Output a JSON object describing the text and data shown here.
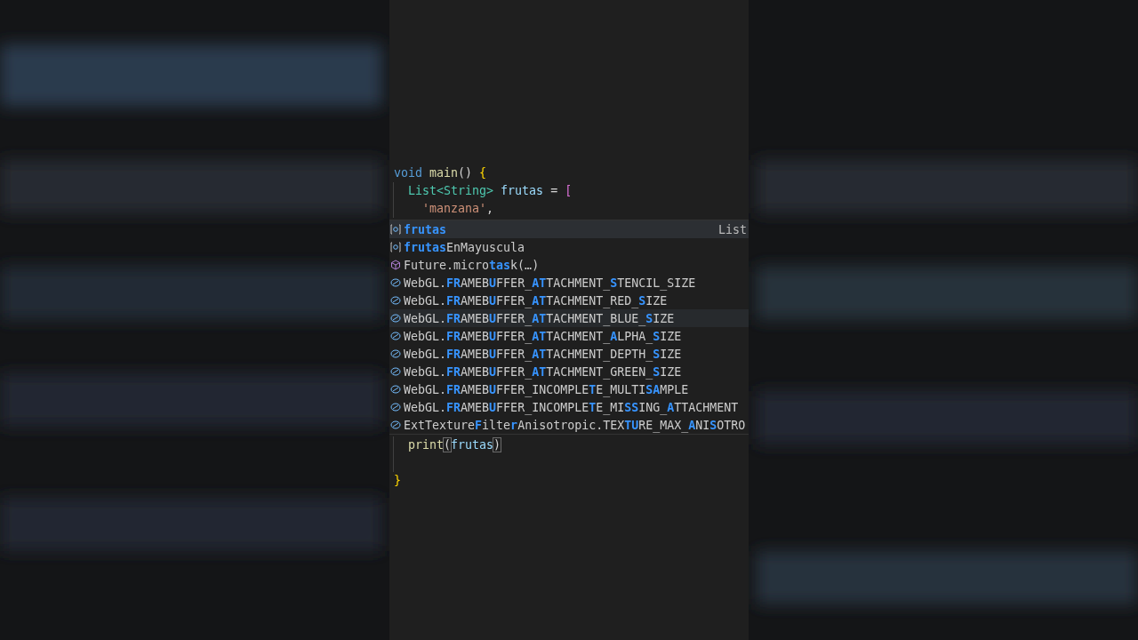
{
  "editor": {
    "lines_before": [
      {
        "guide": false,
        "tokens": [
          {
            "text": "void",
            "kind": "keyword"
          },
          {
            "text": " main",
            "kind": "function"
          },
          {
            "text": "()",
            "kind": "plain"
          },
          {
            "text": " {",
            "kind": "brace"
          }
        ]
      },
      {
        "guide": true,
        "tokens": [
          {
            "text": "  List<String>",
            "kind": "type"
          },
          {
            "text": " frutas",
            "kind": "variable"
          },
          {
            "text": " =",
            "kind": "plain"
          },
          {
            "text": " [",
            "kind": "bracket"
          }
        ]
      },
      {
        "guide": true,
        "tokens": [
          {
            "text": "    'manzana'",
            "kind": "string"
          },
          {
            "text": ",",
            "kind": "plain"
          }
        ]
      }
    ],
    "suggestions": [
      {
        "kind": "variable",
        "label": "**frutas**",
        "detail": "List",
        "selected": true,
        "hovered": false
      },
      {
        "kind": "variable",
        "label": "**frutas**EnMayuscula",
        "selected": false,
        "hovered": false
      },
      {
        "kind": "method",
        "label": "Future.micro**tas**k(…)",
        "selected": false,
        "hovered": false
      },
      {
        "kind": "constant",
        "label": "WebGL.**FR**AMEB**U**FFER_**AT**TACHMENT_**S**TENCIL_SIZE",
        "selected": false,
        "hovered": false
      },
      {
        "kind": "constant",
        "label": "WebGL.**FR**AMEB**U**FFER_**AT**TACHMENT_RED_**S**IZE",
        "selected": false,
        "hovered": false
      },
      {
        "kind": "constant",
        "label": "WebGL.**FR**AMEB**U**FFER_**AT**TACHMENT_BLUE_**S**IZE",
        "selected": false,
        "hovered": true
      },
      {
        "kind": "constant",
        "label": "WebGL.**FR**AMEB**U**FFER_**AT**TACHMENT_**A**LPHA_**S**IZE",
        "selected": false,
        "hovered": false
      },
      {
        "kind": "constant",
        "label": "WebGL.**FR**AMEB**U**FFER_**AT**TACHMENT_DEPTH_**S**IZE",
        "selected": false,
        "hovered": false
      },
      {
        "kind": "constant",
        "label": "WebGL.**FR**AMEB**U**FFER_**AT**TACHMENT_GREEN_**S**IZE",
        "selected": false,
        "hovered": false
      },
      {
        "kind": "constant",
        "label": "WebGL.**FR**AMEB**U**FFER_INCOMPLE**T**E_MULTI**SA**MPLE",
        "selected": false,
        "hovered": false
      },
      {
        "kind": "constant",
        "label": "WebGL.**FR**AMEB**U**FFER_INCOMPLE**T**E_MI**SS**ING_**A**TTACHMENT",
        "selected": false,
        "hovered": false
      },
      {
        "kind": "constant",
        "label": "ExtTexture**F**ilte**r**Anisotropic.TEX**TU**RE_MAX_**A**NI**S**OTRO",
        "selected": false,
        "hovered": false
      }
    ],
    "lines_after": [
      {
        "guide": true,
        "tokens": [
          {
            "text": "  print",
            "kind": "function"
          },
          {
            "text": "(",
            "kind": "match"
          },
          {
            "text": "frutas",
            "kind": "variable"
          },
          {
            "text": ")",
            "kind": "match"
          }
        ]
      },
      {
        "guide": true
      },
      {
        "guide": false,
        "tokens": [
          {
            "text": "}",
            "kind": "brace"
          }
        ]
      }
    ]
  }
}
